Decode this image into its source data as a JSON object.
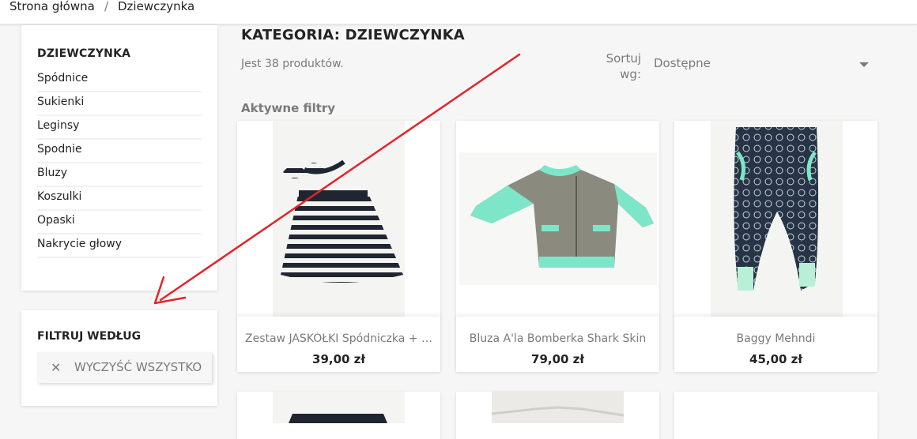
{
  "breadcrumb": {
    "home": "Strona główna",
    "separator": "/",
    "current": "Dziewczynka"
  },
  "sidebar": {
    "category_title": "DZIEWCZYNKA",
    "items": [
      {
        "label": "Spódnice"
      },
      {
        "label": "Sukienki"
      },
      {
        "label": "Leginsy"
      },
      {
        "label": "Spodnie"
      },
      {
        "label": "Bluzy"
      },
      {
        "label": "Koszulki"
      },
      {
        "label": "Opaski"
      },
      {
        "label": "Nakrycie głowy"
      }
    ],
    "filter_title": "FILTRUJ WEDŁUG",
    "clear_all": "WYCZYŚĆ WSZYSTKO",
    "clear_icon": "close-icon"
  },
  "main": {
    "title": "KATEGORIA: DZIEWCZYNKA",
    "product_count": "Jest 38 produktów.",
    "sort_label": "Sortuj wg:",
    "sort_value": "Dostępne",
    "active_filters": "Aktywne filtry",
    "products": [
      {
        "name": "Zestaw JASKÓŁKI Spódniczka + opaska",
        "price": "39,00 zł",
        "image": "striped-skirt-and-headband"
      },
      {
        "name": "Bluza A'la Bomberka Shark Skin",
        "price": "79,00 zł",
        "image": "grey-mint-bomber-jacket"
      },
      {
        "name": "Baggy Mehndi",
        "price": "45,00 zł",
        "image": "navy-mehndi-baggy-pants"
      }
    ]
  },
  "colors": {
    "text": "#232323",
    "muted": "#7a7a7a",
    "background": "#f6f6f6",
    "annotation_arrow": "#e0252b",
    "mint": "#7ee6c8"
  }
}
